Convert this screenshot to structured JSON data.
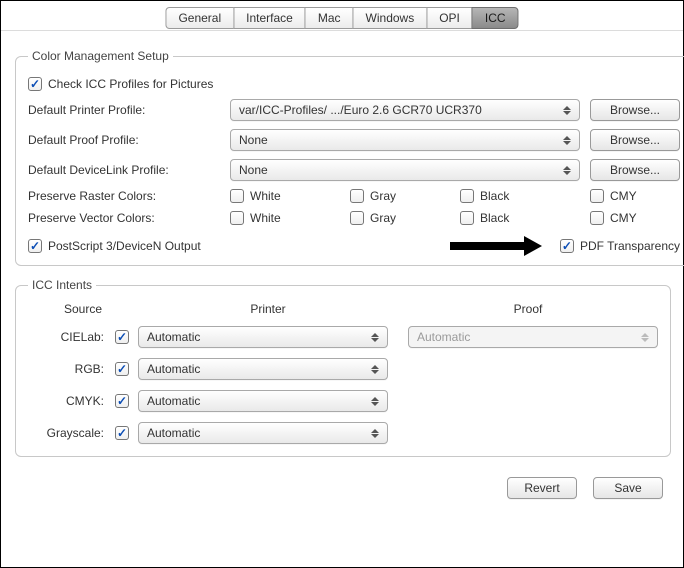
{
  "tabs": [
    "General",
    "Interface",
    "Mac",
    "Windows",
    "OPI",
    "ICC"
  ],
  "active_tab": "ICC",
  "cms": {
    "legend": "Color Management Setup",
    "check_icc": {
      "label": "Check ICC Profiles for Pictures",
      "checked": true
    },
    "printer": {
      "label": "Default Printer Profile:",
      "value": "var/ICC-Profiles/ .../Euro 2.6 GCR70 UCR370",
      "browse": "Browse..."
    },
    "proof": {
      "label": "Default Proof Profile:",
      "value": "None",
      "browse": "Browse..."
    },
    "devlink": {
      "label": "Default DeviceLink Profile:",
      "value": "None",
      "browse": "Browse..."
    },
    "preserve_raster": {
      "label": "Preserve Raster Colors:",
      "options": [
        "White",
        "Gray",
        "Black",
        "CMY"
      ]
    },
    "preserve_vector": {
      "label": "Preserve Vector Colors:",
      "options": [
        "White",
        "Gray",
        "Black",
        "CMY"
      ]
    },
    "ps3": {
      "label": "PostScript 3/DeviceN Output",
      "checked": true
    },
    "pdf_trans": {
      "label": "PDF Transparency",
      "checked": true
    }
  },
  "intents": {
    "legend": "ICC Intents",
    "headers": {
      "source": "Source",
      "printer": "Printer",
      "proof": "Proof"
    },
    "rows": [
      {
        "label": "CIELab:",
        "checked": true,
        "printer": "Automatic",
        "proof": "Automatic",
        "proof_disabled": true
      },
      {
        "label": "RGB:",
        "checked": true,
        "printer": "Automatic"
      },
      {
        "label": "CMYK:",
        "checked": true,
        "printer": "Automatic"
      },
      {
        "label": "Grayscale:",
        "checked": true,
        "printer": "Automatic"
      }
    ]
  },
  "footer": {
    "revert": "Revert",
    "save": "Save"
  }
}
